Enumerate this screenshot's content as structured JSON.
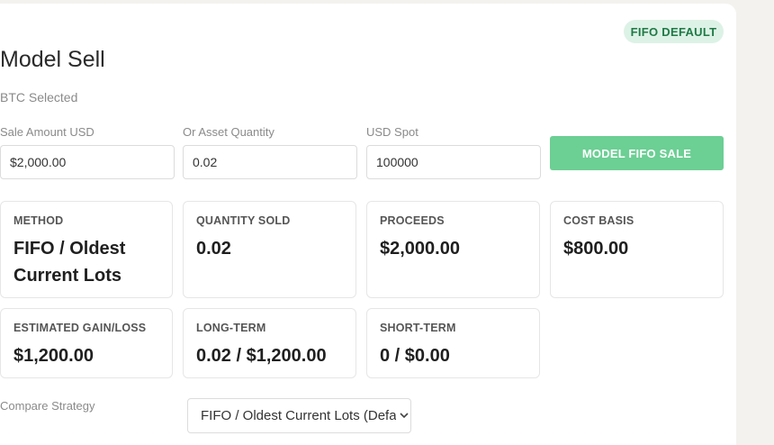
{
  "badge": {
    "label": "FIFO DEFAULT"
  },
  "header": {
    "title": "Model Sell",
    "subtitle": "BTC Selected"
  },
  "form": {
    "sale_amount": {
      "label": "Sale Amount USD",
      "value": "$2,000.00"
    },
    "asset_quantity": {
      "label": "Or Asset Quantity",
      "value": "0.02"
    },
    "usd_spot": {
      "label": "USD Spot",
      "value": "100000"
    },
    "submit_label": "MODEL FIFO SALE"
  },
  "stats": {
    "method": {
      "label": "METHOD",
      "value": "FIFO / Oldest Current Lots"
    },
    "quantity_sold": {
      "label": "QUANTITY SOLD",
      "value": "0.02"
    },
    "proceeds": {
      "label": "PROCEEDS",
      "value": "$2,000.00"
    },
    "cost_basis": {
      "label": "COST BASIS",
      "value": "$800.00"
    },
    "gain_loss": {
      "label": "ESTIMATED GAIN/LOSS",
      "value": "$1,200.00"
    },
    "long_term": {
      "label": "LONG-TERM",
      "value": "0.02 / $1,200.00"
    },
    "short_term": {
      "label": "SHORT-TERM",
      "value": "0 / $0.00"
    }
  },
  "compare": {
    "label": "Compare Strategy",
    "selected": "FIFO / Oldest Current Lots (Default)"
  },
  "colors": {
    "accent": "#6ccf94",
    "badge_bg": "#ddf2e6",
    "badge_text": "#1f7a46"
  },
  "icons": {
    "select_chevron": "chevron-down-icon"
  }
}
